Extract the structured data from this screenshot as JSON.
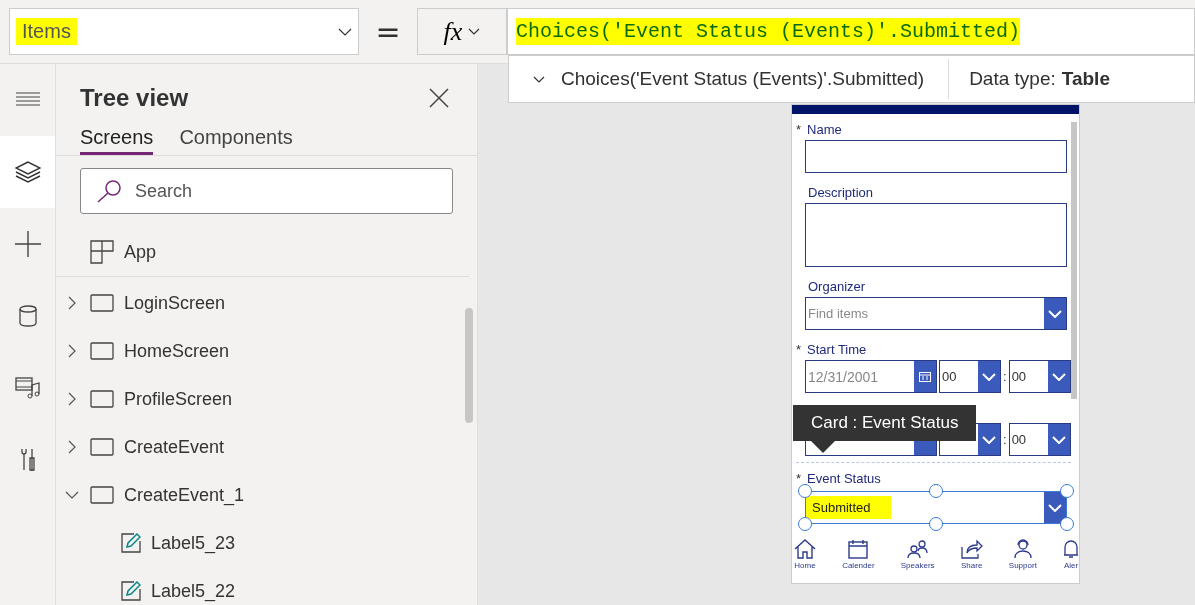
{
  "property": {
    "value": "Items"
  },
  "equals": "=",
  "fx": "fx",
  "formula": {
    "text": "Choices('Event Status (Events)'.Submitted)",
    "suggestion": "Choices('Event Status (Events)'.Submitted)",
    "type_label": "Data type:",
    "type_value": "Table"
  },
  "rail": [
    {
      "kind": "menu",
      "selected": false
    },
    {
      "kind": "layers",
      "selected": true
    },
    {
      "kind": "insert",
      "selected": false
    },
    {
      "kind": "data",
      "selected": false
    },
    {
      "kind": "media",
      "selected": false
    },
    {
      "kind": "tools",
      "selected": false
    }
  ],
  "tree_view": {
    "title": "Tree view",
    "tabs": [
      {
        "label": "Screens",
        "selected": true
      },
      {
        "label": "Components",
        "selected": false
      }
    ],
    "search": {
      "placeholder": "Search"
    },
    "items": [
      {
        "kind": "app",
        "label": "App"
      },
      {
        "kind": "screen",
        "label": "LoginScreen",
        "expanded": false
      },
      {
        "kind": "screen",
        "label": "HomeScreen",
        "expanded": false
      },
      {
        "kind": "screen",
        "label": "ProfileScreen",
        "expanded": false
      },
      {
        "kind": "screen",
        "label": "CreateEvent",
        "expanded": false
      },
      {
        "kind": "screen",
        "label": "CreateEvent_1",
        "expanded": true,
        "children": [
          {
            "kind": "label",
            "label": "Label5_23"
          },
          {
            "kind": "label",
            "label": "Label5_22"
          }
        ]
      }
    ]
  },
  "form": {
    "name": {
      "label": "Name",
      "required": true
    },
    "description": {
      "label": "Description",
      "required": false
    },
    "organizer": {
      "label": "Organizer",
      "required": false,
      "placeholder": "Find items"
    },
    "start_time": {
      "label": "Start Time",
      "required": true,
      "date": "12/31/2001",
      "hour": "00",
      "minute": "00",
      "separator": ":"
    },
    "end_time": {
      "minute": "00",
      "separator": ":"
    },
    "event_status": {
      "label": "Event Status",
      "required": true,
      "value": "Submitted"
    },
    "required_mark": "*"
  },
  "tooltip": "Card : Event Status",
  "nav": [
    {
      "kind": "home",
      "label": "Home"
    },
    {
      "kind": "calendar",
      "label": "Calender"
    },
    {
      "kind": "speakers",
      "label": "Speakers"
    },
    {
      "kind": "share",
      "label": "Share"
    },
    {
      "kind": "support",
      "label": "Support"
    },
    {
      "kind": "alert",
      "label": "Aler"
    }
  ]
}
